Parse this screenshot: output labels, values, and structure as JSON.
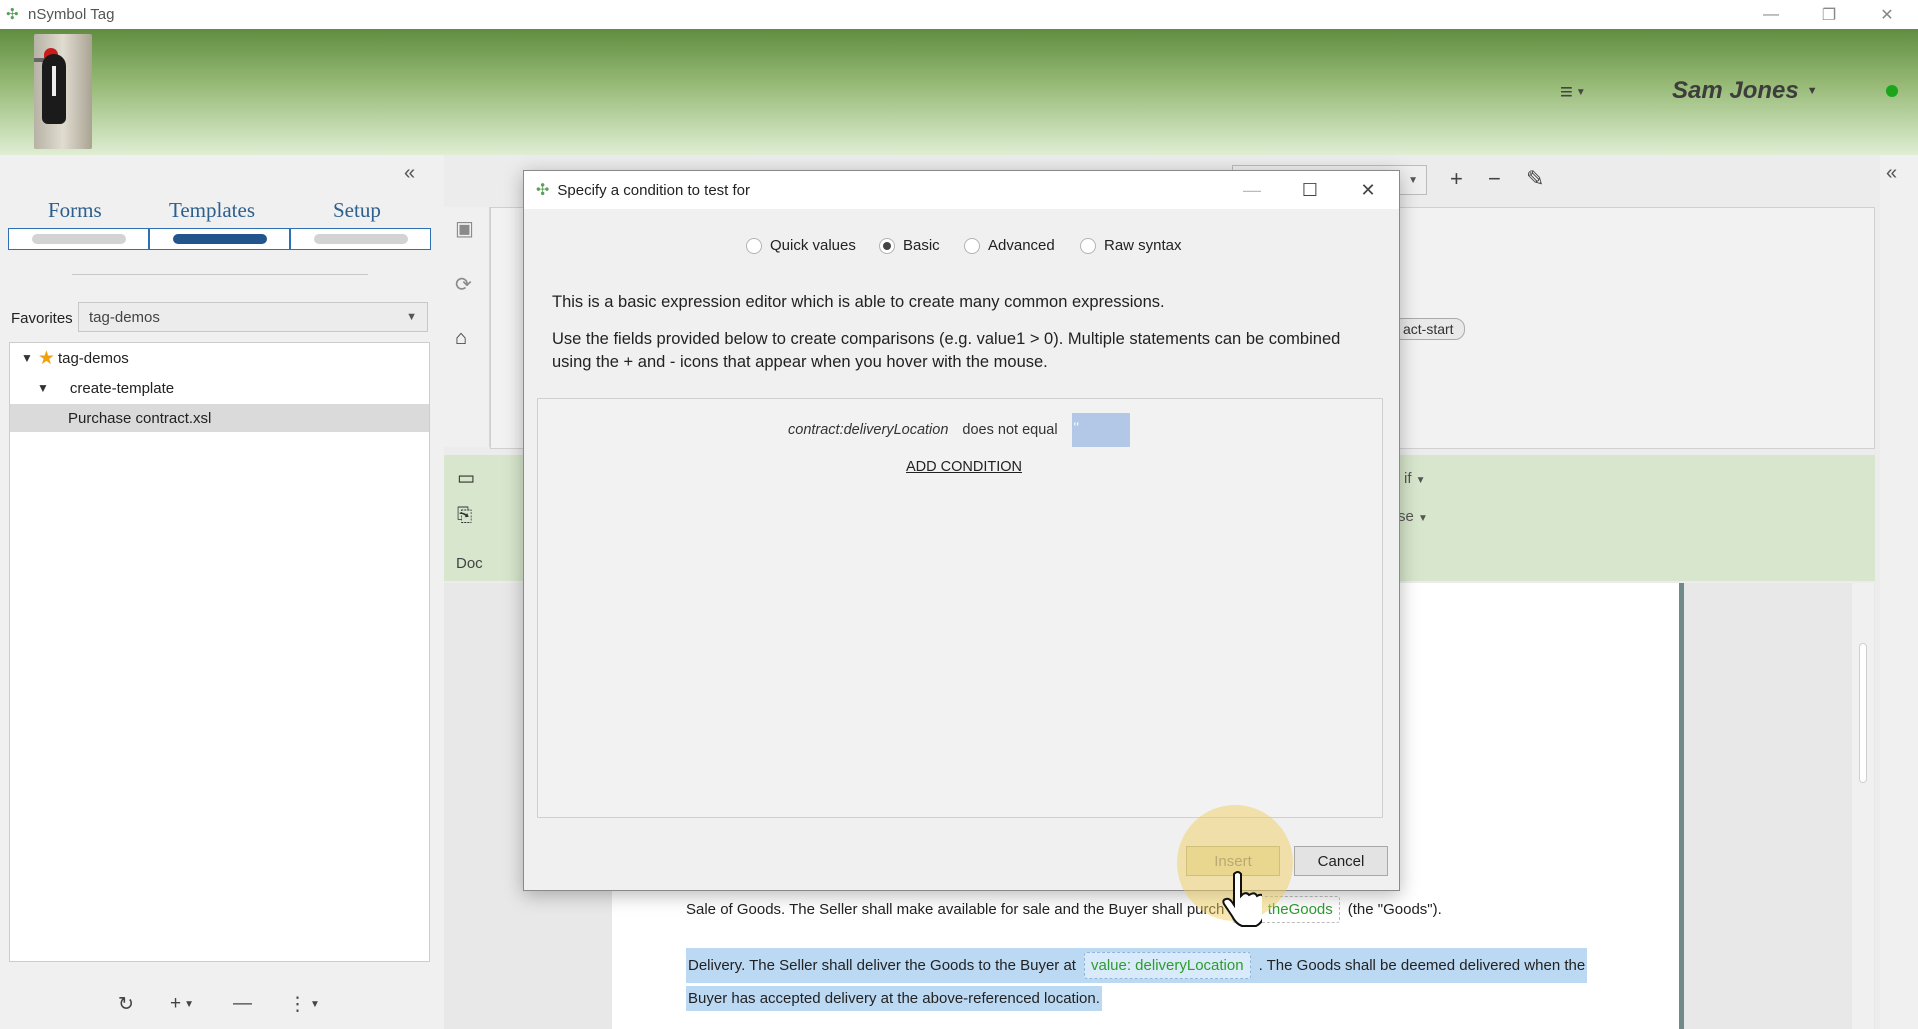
{
  "window": {
    "title": "nSymbol Tag",
    "controls": {
      "minimize": "—",
      "restore": "❐",
      "close": "✕"
    }
  },
  "header": {
    "menu_icon": "hamburger-icon",
    "user_name": "Sam Jones",
    "status_color": "#1aa51a"
  },
  "sidebar": {
    "tabs": [
      {
        "label": "Forms"
      },
      {
        "label": "Templates"
      },
      {
        "label": "Setup"
      }
    ],
    "active_tab": "Templates",
    "favorites_label": "Favorites",
    "favorites_value": "tag-demos",
    "tree": [
      {
        "label": "tag-demos",
        "level": 0,
        "expanded": true,
        "favorite": true
      },
      {
        "label": "create-template",
        "level": 1,
        "expanded": true
      },
      {
        "label": "Purchase contract.xsl",
        "level": 2,
        "selected": true
      }
    ],
    "bottom_tools": [
      "refresh-icon",
      "add-icon",
      "remove-icon",
      "more-icon"
    ]
  },
  "main": {
    "tag_chip": "act-start",
    "green_panel_items": [
      "if",
      "se"
    ],
    "doc_label": "Doc",
    "document": {
      "line1": {
        "before": "Sale of Goods. The Seller shall make available for sale and the Buyer shall purch",
        "field": "lue: theGoods",
        "after": "(the \"Goods\")."
      },
      "line2": {
        "before": "Delivery. The Seller shall deliver the Goods to the Buyer at",
        "field": "value: deliveryLocation",
        "after": ". The Goods shall be deemed delivered when the"
      },
      "line3": {
        "text": "Buyer has accepted delivery at the above-referenced location."
      }
    }
  },
  "dialog": {
    "title": "Specify a condition to test for",
    "modes": [
      {
        "label": "Quick values",
        "selected": false
      },
      {
        "label": "Basic",
        "selected": true
      },
      {
        "label": "Advanced",
        "selected": false
      },
      {
        "label": "Raw syntax",
        "selected": false
      }
    ],
    "description1": "This is a basic expression editor which is able to create many common expressions.",
    "description2": "Use the fields provided below to create comparisons (e.g. value1 > 0). Multiple statements can be combined using the + and - icons that appear when you hover with the mouse.",
    "condition": {
      "field": "contract:deliveryLocation",
      "operator": "does not equal",
      "value": "''"
    },
    "add_condition_label": "ADD CONDITION",
    "insert_label": "Insert",
    "cancel_label": "Cancel"
  }
}
